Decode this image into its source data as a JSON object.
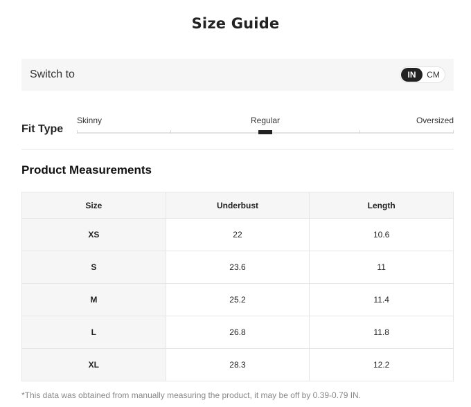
{
  "title": "Size Guide",
  "switch": {
    "label": "Switch to",
    "options": [
      "IN",
      "CM"
    ],
    "selected": "IN"
  },
  "fit": {
    "label": "Fit Type",
    "scale": [
      "Skinny",
      "Regular",
      "Oversized"
    ],
    "selected": "Regular"
  },
  "measurements": {
    "title": "Product Measurements",
    "columns": [
      "Size",
      "Underbust",
      "Length"
    ],
    "rows": [
      [
        "XS",
        "22",
        "10.6"
      ],
      [
        "S",
        "23.6",
        "11"
      ],
      [
        "M",
        "25.2",
        "11.4"
      ],
      [
        "L",
        "26.8",
        "11.8"
      ],
      [
        "XL",
        "28.3",
        "12.2"
      ]
    ]
  },
  "note": "*This data was obtained from manually measuring the product, it may be off by 0.39-0.79 IN."
}
